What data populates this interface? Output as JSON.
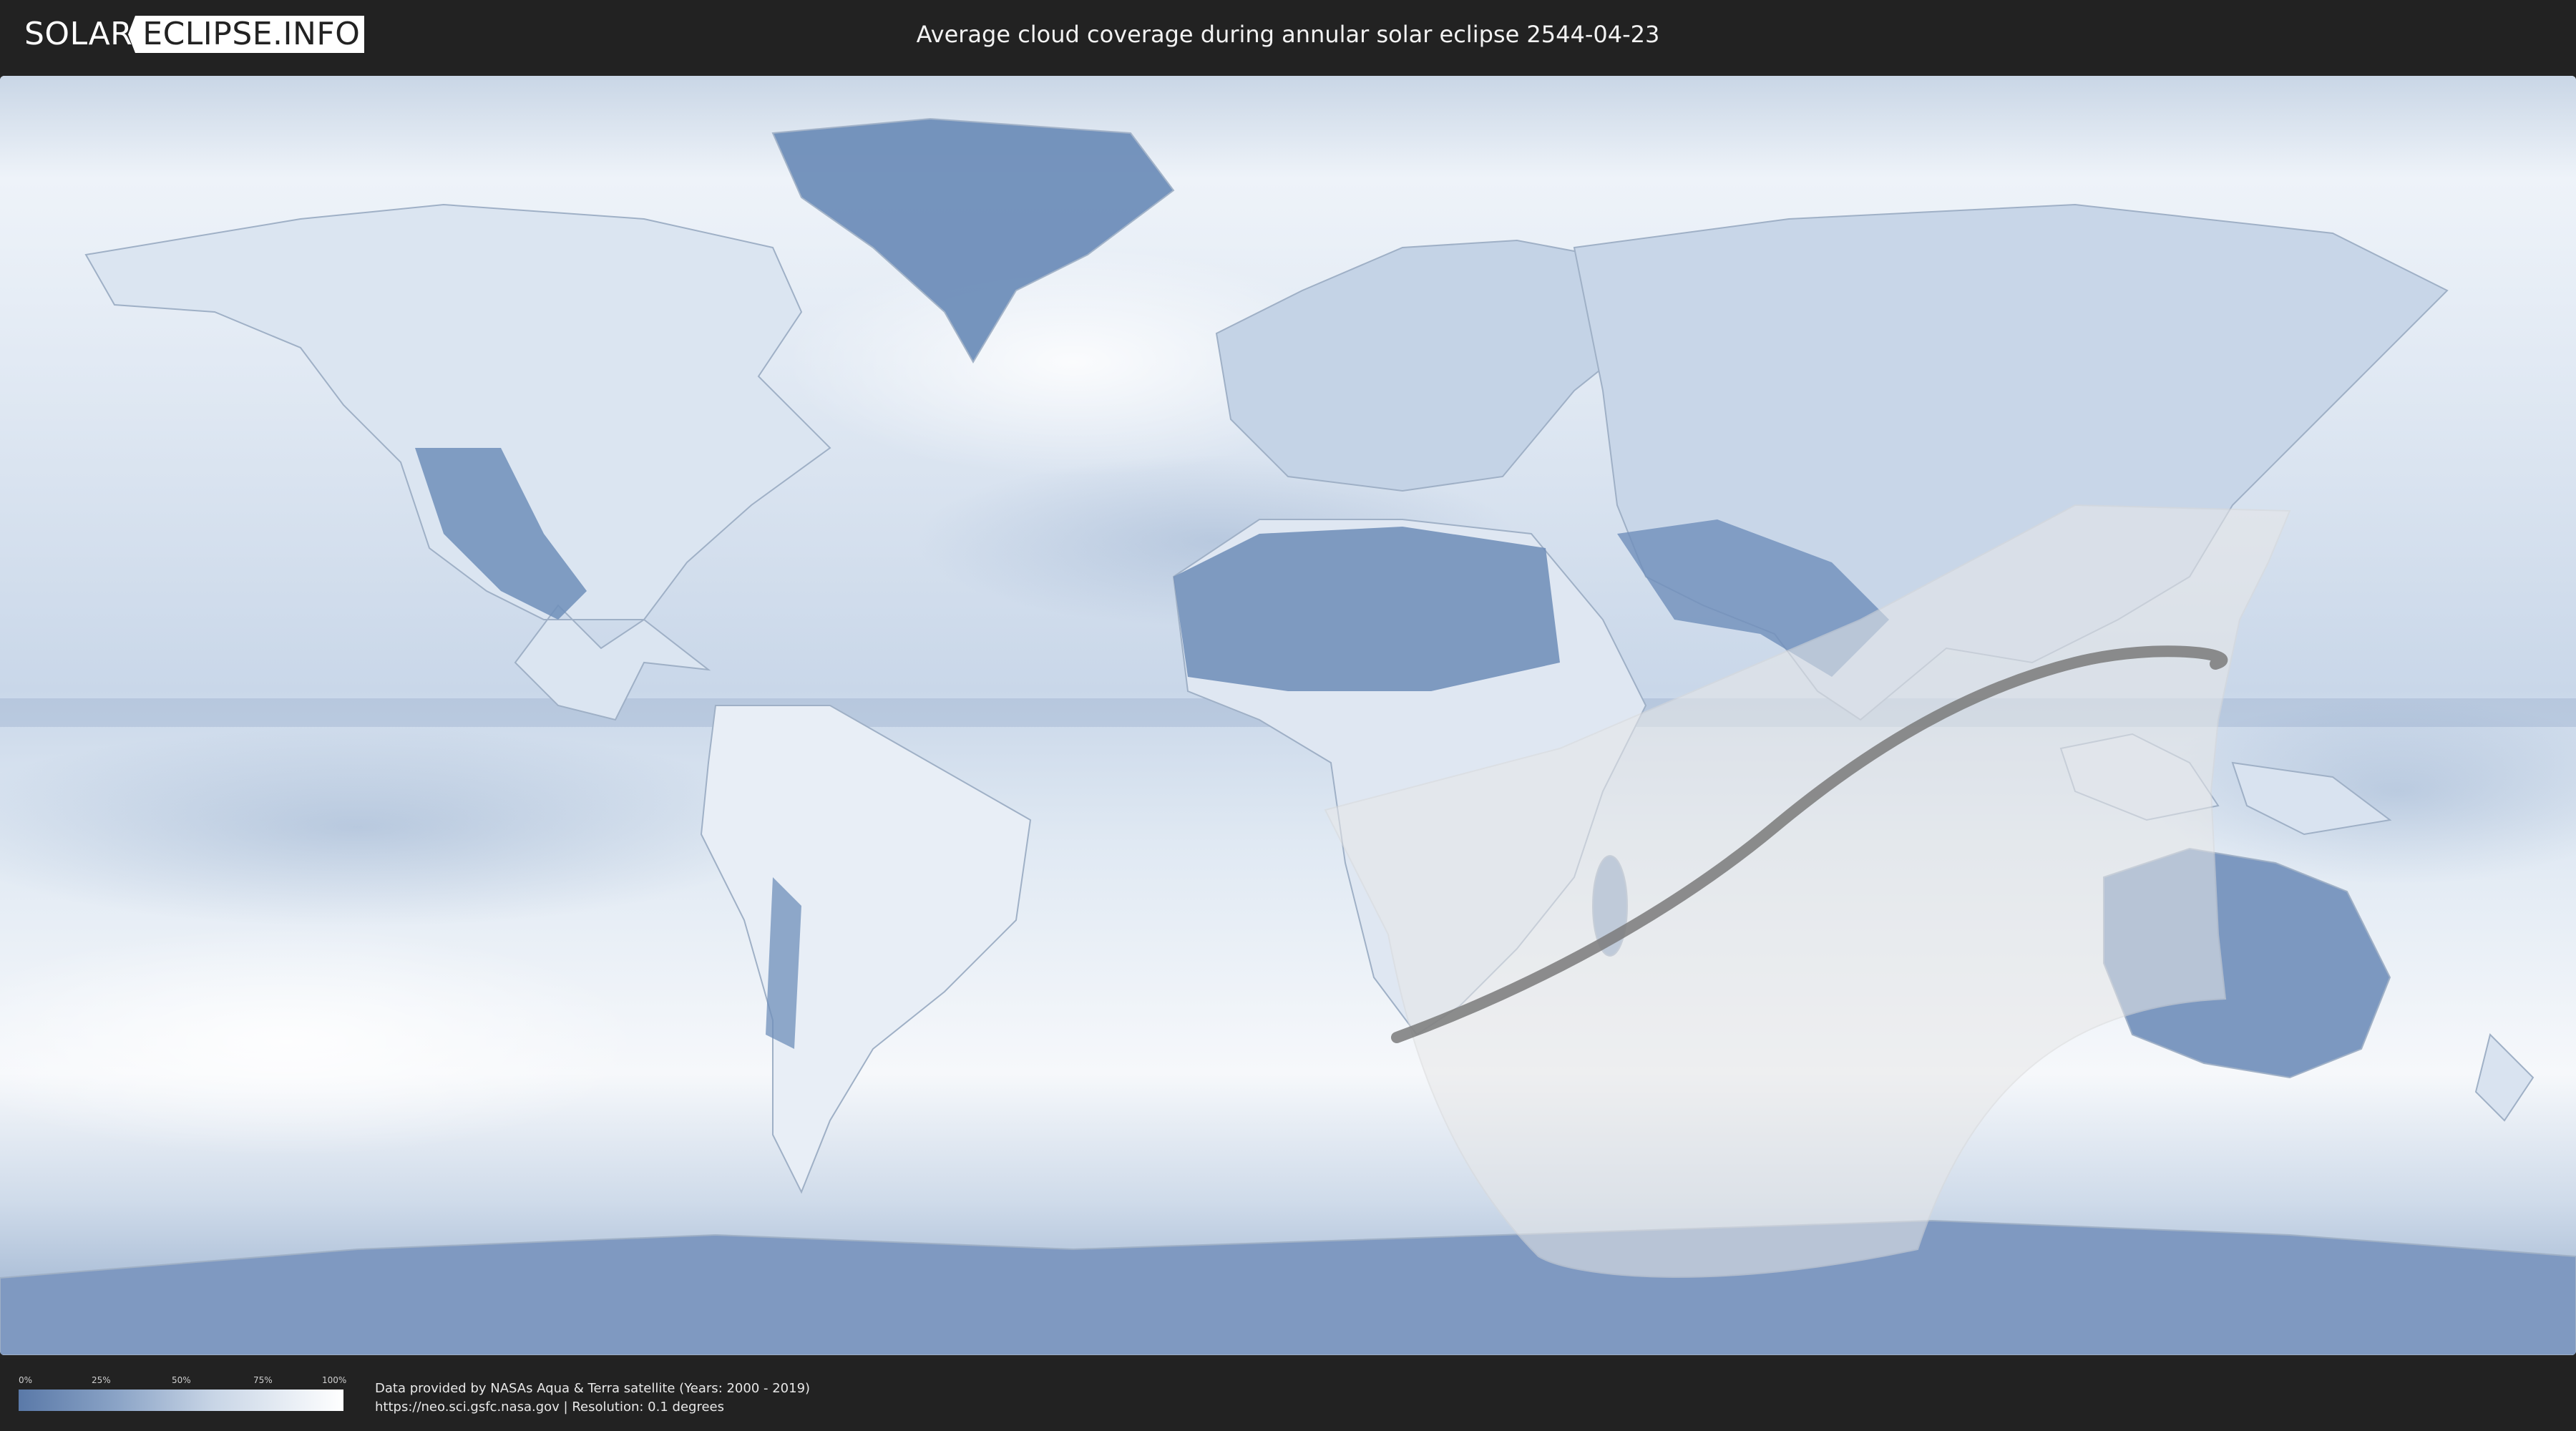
{
  "header": {
    "logo_left": "SOLAR",
    "logo_right": "ECLIPSE.INFO",
    "title": "Average cloud coverage during annular solar eclipse 2544-04-23"
  },
  "map": {
    "description_icon": "world-map-icon",
    "colors": {
      "ocean_cloud": "#e7eef6",
      "clear_land": "#6f8fba",
      "eclipse_shade": "#e8e8e8",
      "central_path": "#7a7a7a",
      "boundary_lines": "#9fb0c6"
    }
  },
  "legend": {
    "ticks": [
      "0%",
      "25%",
      "50%",
      "75%",
      "100%"
    ],
    "gradient_start": "#5a79a8",
    "gradient_end": "#ffffff"
  },
  "credits": {
    "line1": "Data provided by NASAs Aqua & Terra satellite (Years: 2000 - 2019)",
    "line2": "https://neo.sci.gsfc.nasa.gov | Resolution: 0.1 degrees"
  }
}
